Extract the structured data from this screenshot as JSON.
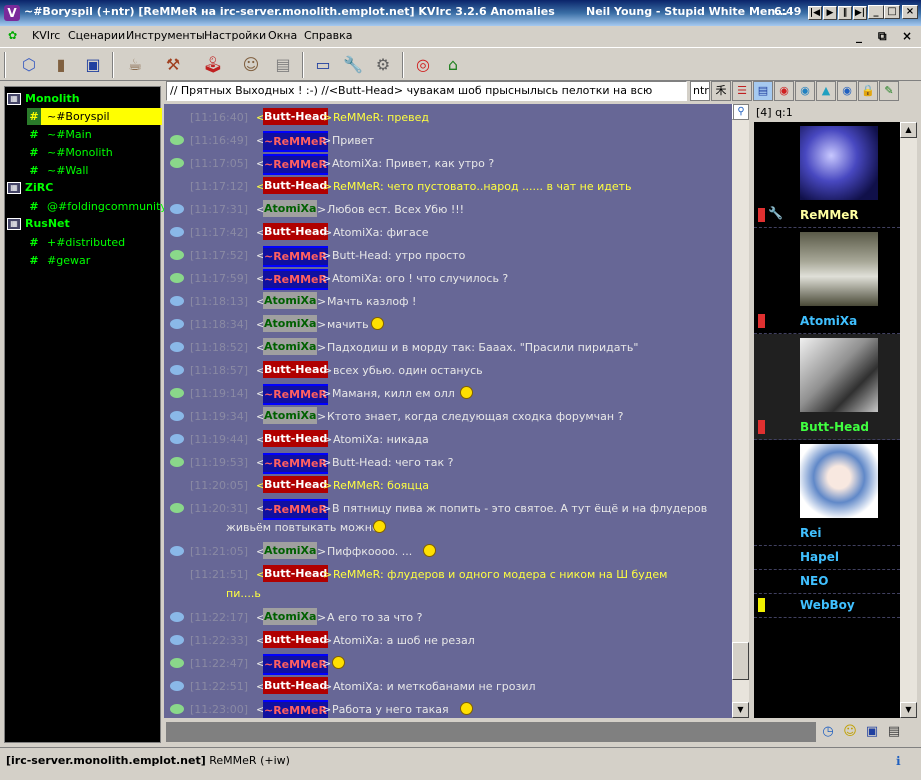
{
  "window": {
    "title": "~#Boryspil (+ntr) [ReMMeR на irc-server.monolith.emplot.net] KVIrc 3.2.6 Anomalies",
    "now_playing": "Neil Young - Stupid White Men...",
    "clock": "6:49"
  },
  "menu": [
    "KVIrc",
    "Сценарии",
    "Инструменты",
    "Настройки",
    "Окна",
    "Справка"
  ],
  "tree": [
    {
      "type": "net",
      "label": "Monolith"
    },
    {
      "type": "chan",
      "label": "~#Boryspil",
      "selected": true
    },
    {
      "type": "chan",
      "label": "~#Main"
    },
    {
      "type": "chan",
      "label": "~#Monolith"
    },
    {
      "type": "chan",
      "label": "~#Wall"
    },
    {
      "type": "net",
      "label": "ZiRC"
    },
    {
      "type": "chan",
      "label": "@#foldingcommunity"
    },
    {
      "type": "net",
      "label": "RusNet"
    },
    {
      "type": "chan",
      "label": "+#distributed"
    },
    {
      "type": "chan",
      "label": "#gewar"
    }
  ],
  "topic": "// Прятных Выходных ! :-) //<Butt-Head> чувакам шоб прыснылысь пелотки на всю",
  "topic_input": "ntr",
  "userlist_header": "[4] q:1",
  "users": [
    {
      "nick": "ReMMeR",
      "color": "#ffffa0",
      "flag": "#e03030",
      "avatar": "logo"
    },
    {
      "nick": "AtomiXa",
      "color": "#40c0ff",
      "flag": "#e03030",
      "avatar": "wolf"
    },
    {
      "nick": "Butt-Head",
      "color": "#40ff40",
      "flag": "#e03030",
      "avatar": "face"
    },
    {
      "nick": "Rei",
      "color": "#40c0ff",
      "flag": "",
      "avatar": "anime"
    },
    {
      "nick": "Hapel",
      "color": "#40c0ff",
      "flag": "",
      "avatar": ""
    },
    {
      "nick": "NEO",
      "color": "#40c0ff",
      "flag": "",
      "avatar": ""
    },
    {
      "nick": "WebBoy",
      "color": "#40c0ff",
      "flag": "#f0f000",
      "avatar": ""
    }
  ],
  "messages": [
    {
      "time": "[11:16:40]",
      "nick": "Butt-Head",
      "text": "ReMMeR: превед",
      "icon": "",
      "hl": true
    },
    {
      "time": "[11:16:49]",
      "nick": "~ReMMeR",
      "text": "Привет",
      "icon": "g"
    },
    {
      "time": "[11:17:05]",
      "nick": "~ReMMeR",
      "text": "AtomiXa: Привет, как утро ?",
      "icon": "g"
    },
    {
      "time": "[11:17:12]",
      "nick": "Butt-Head",
      "text": "ReMMeR: чето пустовато..народ ...... в чат не идеть",
      "icon": "",
      "hl": true
    },
    {
      "time": "[11:17:31]",
      "nick": "AtomiXa",
      "text": "Любов ест. Всех Убю !!!",
      "icon": "b"
    },
    {
      "time": "[11:17:42]",
      "nick": "Butt-Head",
      "text": "AtomiXa: фигасе",
      "icon": "b"
    },
    {
      "time": "[11:17:52]",
      "nick": "~ReMMeR",
      "text": "Butt-Head: утро просто",
      "icon": "g"
    },
    {
      "time": "[11:17:59]",
      "nick": "~ReMMeR",
      "text": "AtomiXa: ого ! что случилось ?",
      "icon": "g"
    },
    {
      "time": "[11:18:13]",
      "nick": "AtomiXa",
      "text": "Мачть казлоф !",
      "icon": "b"
    },
    {
      "time": "[11:18:34]",
      "nick": "AtomiXa",
      "text": "мачить",
      "icon": "b",
      "smiley": true
    },
    {
      "time": "[11:18:52]",
      "nick": "AtomiXa",
      "text": "Падходиш и в морду так: Бааах. \"Прасили пиридать\"",
      "icon": "b"
    },
    {
      "time": "[11:18:57]",
      "nick": "Butt-Head",
      "text": "всех убью. один останусь",
      "icon": "b"
    },
    {
      "time": "[11:19:14]",
      "nick": "~ReMMeR",
      "text": "Маманя, килл ем олл",
      "icon": "g",
      "smiley": true
    },
    {
      "time": "[11:19:34]",
      "nick": "AtomiXa",
      "text": "Ктото знает, когда следующая сходка форумчан ?",
      "icon": "b"
    },
    {
      "time": "[11:19:44]",
      "nick": "Butt-Head",
      "text": "AtomiXa: никада",
      "icon": "b"
    },
    {
      "time": "[11:19:53]",
      "nick": "~ReMMeR",
      "text": "Butt-Head: чего так ?",
      "icon": "g"
    },
    {
      "time": "[11:20:05]",
      "nick": "Butt-Head",
      "text": "ReMMeR: бояцца",
      "icon": "",
      "hl": true
    },
    {
      "time": "[11:20:31]",
      "nick": "~ReMMeR",
      "text": "В пятницу пива ж попить - это святое. А тут ёщё и на флудеров",
      "cont": "живьём повтыкать можно",
      "icon": "g",
      "smiley_cont": true
    },
    {
      "time": "[11:21:05]",
      "nick": "AtomiXa",
      "text": "Пиффкоооо. ...",
      "icon": "b",
      "smiley": true
    },
    {
      "time": "[11:21:51]",
      "nick": "Butt-Head",
      "text": "ReMMeR: флудеров и одного модера с ником на Ш будем",
      "cont": "пи....ь",
      "icon": "",
      "hl": true
    },
    {
      "time": "[11:22:17]",
      "nick": "AtomiXa",
      "text": "А его то за что ?",
      "icon": "b"
    },
    {
      "time": "[11:22:33]",
      "nick": "Butt-Head",
      "text": "AtomiXa: а шоб не резал",
      "icon": "b"
    },
    {
      "time": "[11:22:47]",
      "nick": "~ReMMeR",
      "text": "",
      "icon": "g",
      "smiley": true
    },
    {
      "time": "[11:22:51]",
      "nick": "Butt-Head",
      "text": "AtomiXa: и меткобанами не грозил",
      "icon": "b"
    },
    {
      "time": "[11:23:00]",
      "nick": "~ReMMeR",
      "text": "Работа у него такая",
      "icon": "g",
      "smiley": true
    }
  ],
  "status": {
    "server": "[irc-server.monolith.emplot.net]",
    "nick": "ReMMeR (+iw)"
  }
}
